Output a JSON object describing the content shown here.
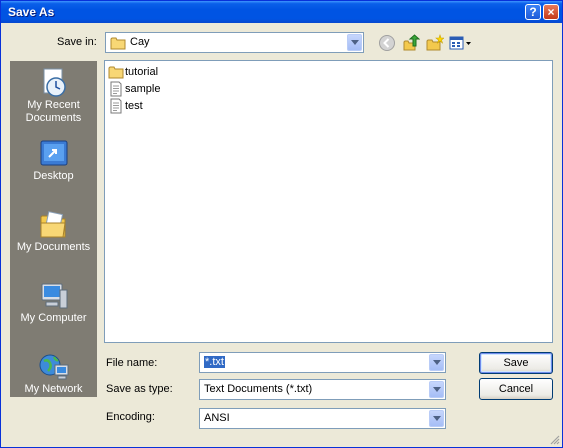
{
  "window": {
    "title": "Save As"
  },
  "titlebar": {
    "help": "?",
    "close": "×"
  },
  "save_in": {
    "label": "Save in:",
    "value": "Cay"
  },
  "places": [
    {
      "label": "My Recent Documents",
      "icon": "recent-documents-icon"
    },
    {
      "label": "Desktop",
      "icon": "desktop-icon"
    },
    {
      "label": "My Documents",
      "icon": "my-documents-icon"
    },
    {
      "label": "My Computer",
      "icon": "my-computer-icon"
    },
    {
      "label": "My Network",
      "icon": "my-network-icon"
    }
  ],
  "files": [
    {
      "name": "tutorial",
      "type": "folder"
    },
    {
      "name": "sample",
      "type": "text-file"
    },
    {
      "name": "test",
      "type": "text-file"
    }
  ],
  "file_name": {
    "label": "File name:",
    "value": "*.txt"
  },
  "save_as_type": {
    "label": "Save as type:",
    "value": "Text Documents (*.txt)"
  },
  "encoding": {
    "label": "Encoding:",
    "value": "ANSI"
  },
  "buttons": {
    "save": "Save",
    "cancel": "Cancel"
  },
  "colors": {
    "titlebar": "#0054E3",
    "dialog_bg": "#ECE9D8",
    "places_bg": "#7F7C73",
    "selection": "#316AC5"
  }
}
